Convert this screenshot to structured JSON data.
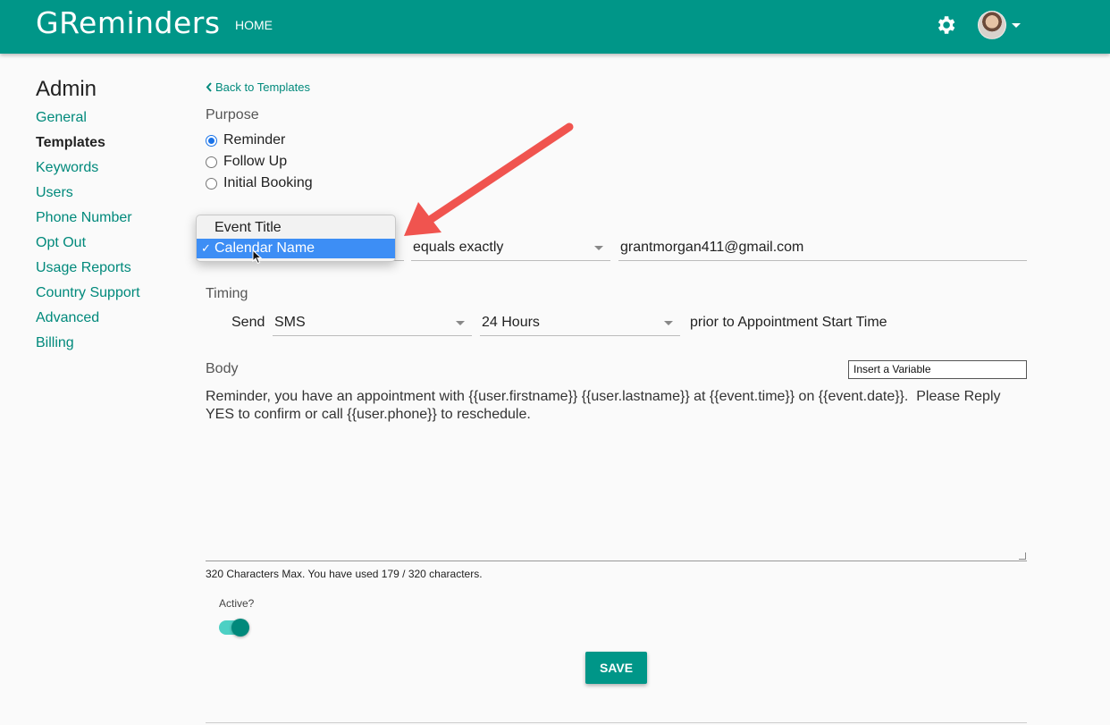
{
  "header": {
    "brand": "GReminders",
    "nav_home": "HOME"
  },
  "sidebar": {
    "title": "Admin",
    "items": [
      {
        "label": "General"
      },
      {
        "label": "Templates"
      },
      {
        "label": "Keywords"
      },
      {
        "label": "Users"
      },
      {
        "label": "Phone Number"
      },
      {
        "label": "Opt Out"
      },
      {
        "label": "Usage Reports"
      },
      {
        "label": "Country Support"
      },
      {
        "label": "Advanced"
      },
      {
        "label": "Billing"
      }
    ],
    "active": "Templates"
  },
  "main": {
    "back_link": "Back to Templates",
    "purpose": {
      "label": "Purpose",
      "options": [
        "Reminder",
        "Follow Up",
        "Initial Booking"
      ],
      "selected": "Reminder"
    },
    "criteria": {
      "dropdown_options": [
        "Event Title",
        "Calendar Name"
      ],
      "selected": "Calendar Name",
      "operator": "equals exactly",
      "value": "grantmorgan411@gmail.com"
    },
    "timing": {
      "label": "Timing",
      "send_label": "Send",
      "channel": "SMS",
      "offset": "24 Hours",
      "suffix": "prior to Appointment Start Time"
    },
    "body": {
      "label": "Body",
      "insert_variable": "Insert a Variable",
      "text_line1": "Reminder, you have an appointment with {{user.firstname}} {{user.lastname}} at {{event.time}} on {{event.date}}.  Please Reply",
      "text_line2": "YES to confirm or call {{user.phone}} to reschedule.",
      "counter": "320 Characters Max. You have used 179 / 320 characters."
    },
    "active": {
      "label": "Active?",
      "on": true
    },
    "save_label": "SAVE"
  },
  "colors": {
    "primary": "#009688",
    "link": "#00897b",
    "annotation_arrow": "#f0544f",
    "selection": "#3d8ef5"
  },
  "icons": [
    "gear-icon",
    "avatar",
    "chevron-left-icon",
    "checkmark-icon",
    "mouse-cursor-icon",
    "annotation-arrow"
  ]
}
